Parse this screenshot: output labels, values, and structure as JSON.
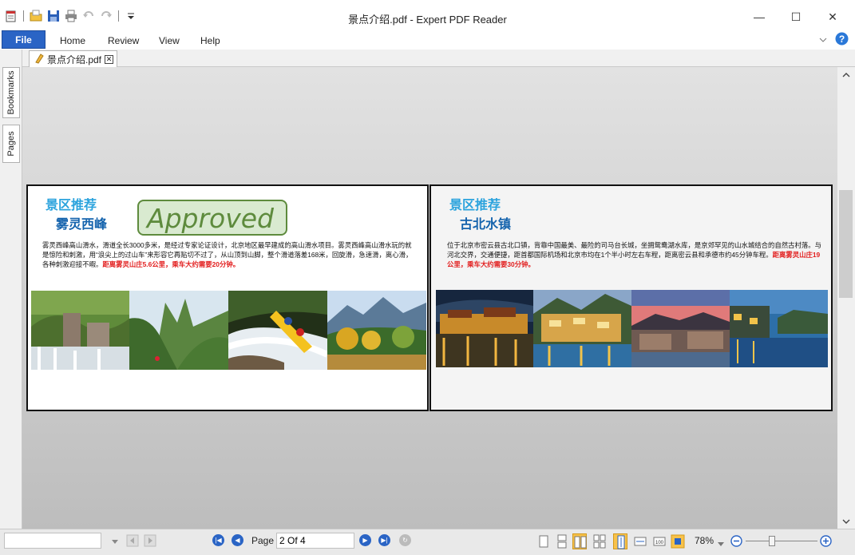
{
  "window": {
    "title": "景点介绍.pdf - Expert PDF Reader",
    "minimize": "—",
    "maximize": "☐",
    "close": "✕"
  },
  "quick_access": {
    "icons": [
      "new-document-icon",
      "open-folder-icon",
      "save-icon",
      "print-icon",
      "undo-icon",
      "redo-icon",
      "customize-dropdown-icon"
    ]
  },
  "ribbon": {
    "file": "File",
    "tabs": [
      "Home",
      "Review",
      "View",
      "Help"
    ]
  },
  "document_tab": {
    "label": "景点介绍.pdf",
    "close": "✕"
  },
  "side_tabs": {
    "bookmarks": "Bookmarks",
    "pages": "Pages"
  },
  "pages": {
    "left": {
      "heading": "景区推荐",
      "subheading": "雾灵西峰",
      "stamp": "Approved",
      "body": "雾灵西峰高山滑水，滑道全长3000多米，是经过专家论证设计，北京地区最早建成的高山滑水项目。雾灵西峰高山滑水玩的就是惊险和刺激，用“浪尖上的过山车”来形容它再贴切不过了，从山顶到山脚，整个滑道落差168米，回旋滑，急速滑，离心滑，各种刺激迎接不暇。",
      "highlight": "距离雾灵山庄5.6公里，乘车大约需要20分钟。"
    },
    "right": {
      "heading": "景区推荐",
      "subheading": "古北水镇",
      "body": "位于北京市密云县古北口镇，背靠中国最美、最险的司马台长城，坐拥鸳鸯湖水库，是京郊罕见的山水城结合的自然古村落。与河北交界，交通便捷，距首都国际机场和北京市均在1个半小时左右车程，距离密云县和承德市约45分钟车程。",
      "highlight": "距离雾灵山庄19公里，乘车大约需要30分钟。"
    }
  },
  "status": {
    "search_value": "",
    "page_label": "Page",
    "page_value": "2 Of 4",
    "zoom": "78%",
    "zoom_level": 0.35
  }
}
